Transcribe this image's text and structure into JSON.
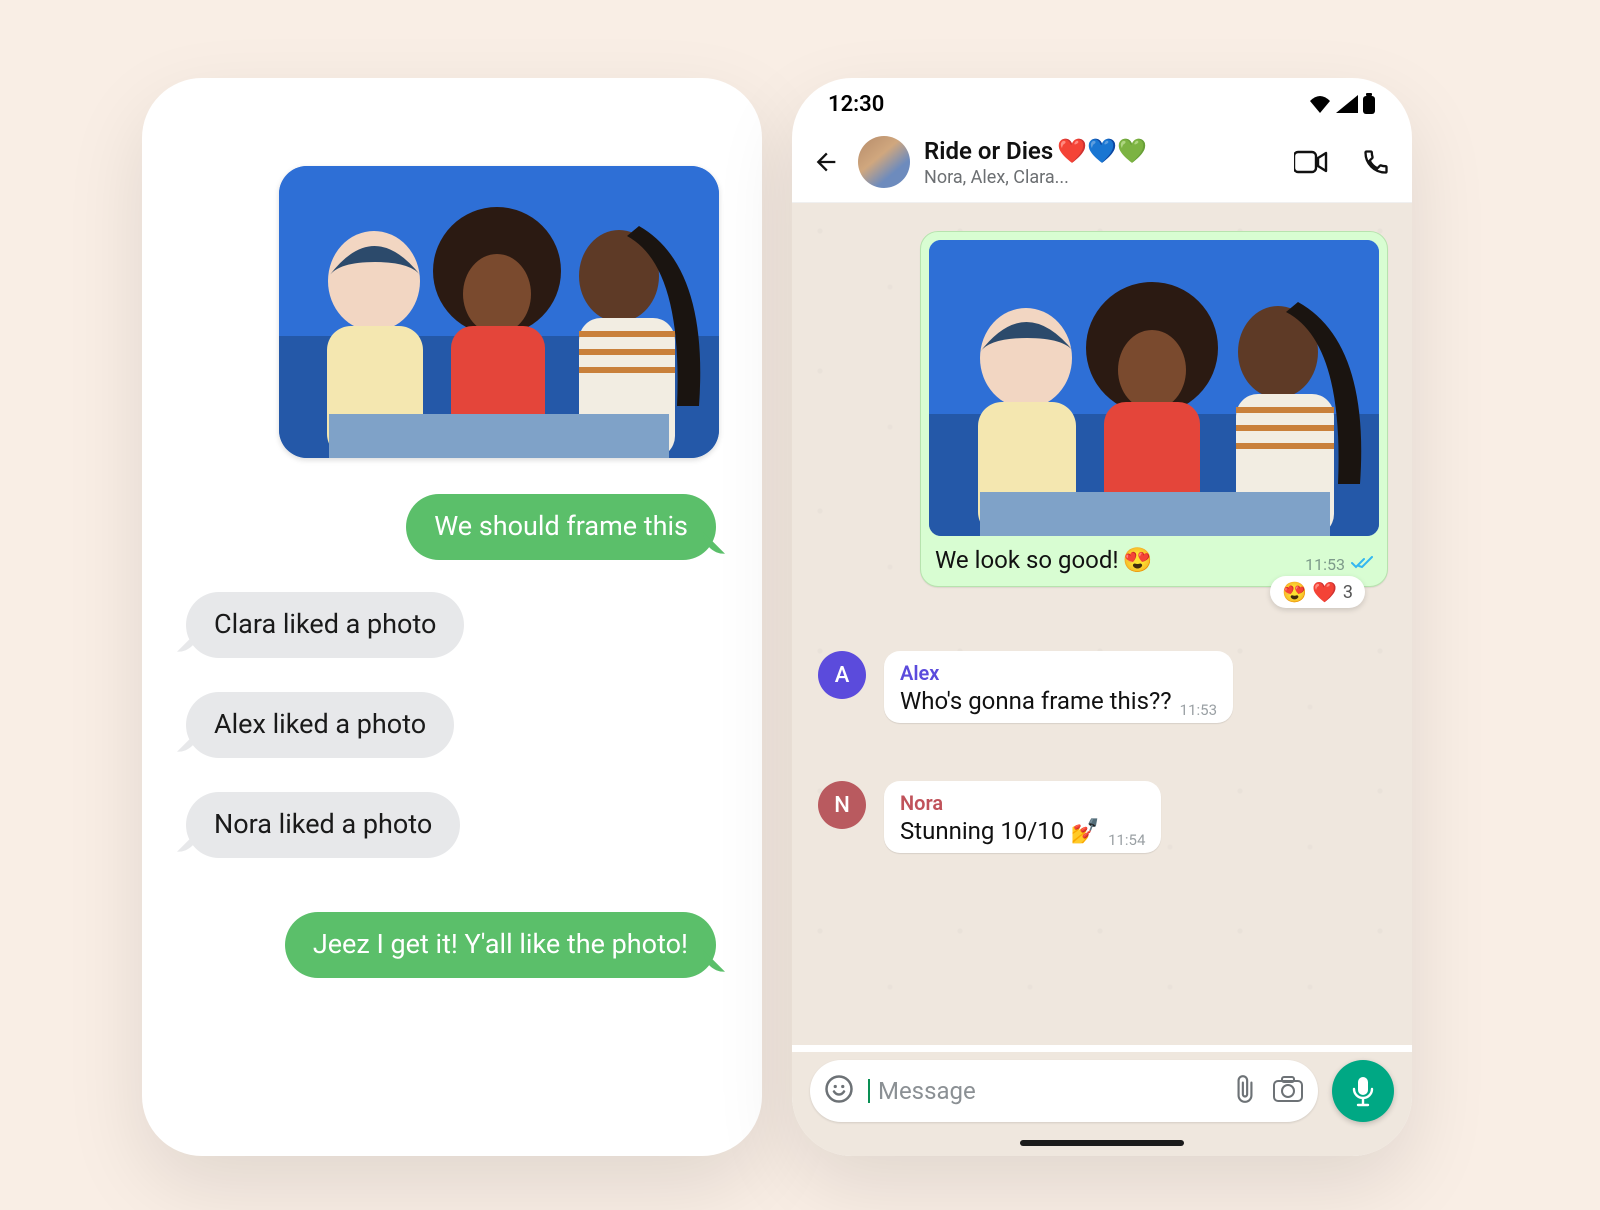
{
  "left": {
    "bubbles": {
      "frame_this": "We should frame this",
      "clara_liked": "Clara liked a photo",
      "alex_liked": "Alex liked a photo",
      "nora_liked": "Nora liked a photo",
      "jeez": "Jeez I get it! Y'all like the photo!"
    }
  },
  "right": {
    "status_time": "12:30",
    "chat_title": "Ride or Dies",
    "chat_title_emoji": "❤️💙💚",
    "chat_sub": "Nora, Alex, Clara...",
    "out_caption": "We look so good!",
    "out_caption_emoji": "😍",
    "out_time": "11:53",
    "reactions": {
      "emojis": "😍 ❤️",
      "count": "3"
    },
    "alex": {
      "name": "Alex",
      "text": "Who's gonna frame this??",
      "time": "11:53",
      "initial": "A"
    },
    "nora": {
      "name": "Nora",
      "text": "Stunning 10/10 💅",
      "time": "11:54",
      "initial": "N"
    },
    "input_placeholder": "Message"
  },
  "colors": {
    "green_bubble": "#5bbf6a",
    "wa_out": "#d8fdd2",
    "wa_accent": "#00a884"
  }
}
